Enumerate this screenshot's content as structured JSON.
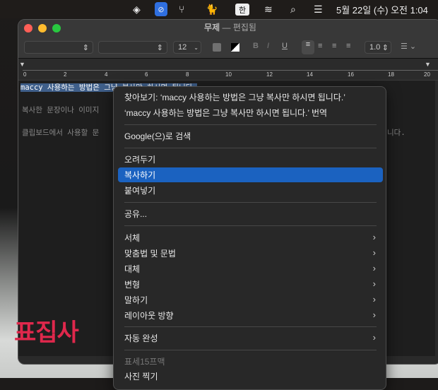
{
  "menubar": {
    "ime": "한",
    "clock": "5월 22일 (수) 오전 1:04"
  },
  "window": {
    "title": "무제",
    "subtitle": "— 편집됨"
  },
  "toolbar": {
    "font_size": "12",
    "line_spacing": "1.0",
    "bold": "B",
    "italic": "I",
    "underline": "U"
  },
  "ruler": {
    "ticks": [
      "0",
      "2",
      "4",
      "6",
      "8",
      "10",
      "12",
      "14",
      "16",
      "18",
      "20"
    ]
  },
  "document": {
    "line1_selected": "maccy 사용하는 방법은 그냥 복사만 하시면 됩니다.",
    "line2": "복사한 문장이나 이미지",
    "line3_start": "클립보드에서 사용할 문",
    "line3_end": "니다."
  },
  "context_menu": {
    "lookup": "찾아보기: ‘maccy 사용하는 방법은 그냥 복사만 하시면 됩니다.’",
    "translate": "‘maccy 사용하는 방법은 그냥 복사만 하시면 됩니다.’ 번역",
    "google": "Google(으)로 검색",
    "cut": "오려두기",
    "copy": "복사하기",
    "paste": "붙여넣기",
    "share": "공유...",
    "font": "서체",
    "spelling": "맞춤법 및 문법",
    "substitutions": "대체",
    "transformations": "변형",
    "speech": "말하기",
    "layout": "레이아웃 방향",
    "autofill": "자동 완성",
    "section_header": "표세15프맥",
    "take_photo": "사진 찍기"
  },
  "watermark": "표집사",
  "colors": {
    "highlight": "#1b62c0",
    "selection": "#3f5f8a",
    "watermark": "#e0284c"
  }
}
